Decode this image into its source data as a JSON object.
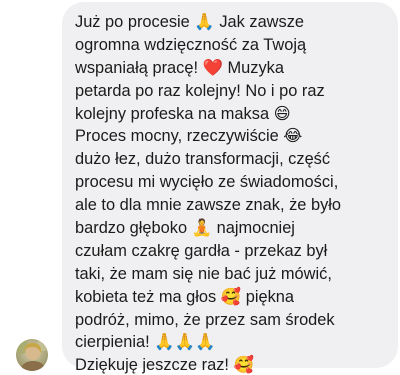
{
  "message": {
    "lines": [
      "Już po procesie 🙏 Jak zawsze",
      "ogromna wdzięczność za Twoją",
      "wspaniałą pracę! ❤️ Muzyka",
      "petarda po raz kolejny! No i po raz",
      "kolejny profeska na maksa 😄",
      "Proces mocny, rzeczywiście 😂",
      "dużo łez, dużo transformacji, część",
      "procesu mi wycięło ze świadomości,",
      "ale to dla mnie zawsze znak, że było",
      "bardzo głęboko 🧘 najmocniej",
      "czułam czakrę gardła - przekaz był",
      "taki, że mam się nie bać już mówić,",
      "kobieta też ma głos 🥰  piękna",
      "podróż, mimo, że przez sam środek",
      "cierpienia! 🙏🙏🙏",
      "Dziękuję jeszcze raz! 🥰"
    ]
  },
  "sender": {
    "avatar_icon": "profile-photo-avatar"
  },
  "colors": {
    "bubble_background": "#f0f0f2",
    "text": "#1b1b1b",
    "page_background": "#ffffff"
  }
}
